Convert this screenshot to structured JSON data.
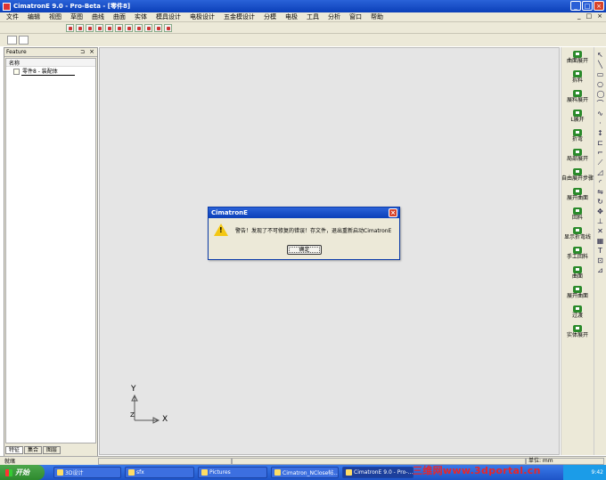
{
  "window": {
    "title": "CimatronE 9.0 - Pro-Beta - [零件8]",
    "controls": [
      "_",
      "□",
      "×"
    ]
  },
  "menu": {
    "items": [
      "文件",
      "编辑",
      "视图",
      "草图",
      "曲线",
      "曲面",
      "实体",
      "模具设计",
      "电极设计",
      "五金模设计",
      "分模",
      "电极",
      "工具",
      "分析",
      "窗口",
      "帮助"
    ],
    "mdi_controls": [
      "_",
      "□",
      "×"
    ]
  },
  "left_panel": {
    "title": "Feature",
    "pin": "⊐",
    "close": "×",
    "column_header": "名称",
    "tree_item": "零件8 - 装配体",
    "tabs": [
      "特征",
      "集合",
      "图层"
    ]
  },
  "canvas": {
    "axis_x": "X",
    "axis_y": "Y",
    "axis_z": "Z"
  },
  "right_toolbar": {
    "items": [
      "曲面展开",
      "拆料",
      "展料展开",
      "L展开",
      "折弯",
      "局部展开",
      "自由展开步骤",
      "展开曲面",
      "回料",
      "显示折弯线",
      "手工回料",
      "曲面",
      "展开曲面",
      "过渡",
      "实体展开"
    ]
  },
  "dialog": {
    "title": "CimatronE",
    "message": "警告！发现了不可修复的错误！存文件，退出重新启动CimatronE",
    "ok_label": "确定",
    "close": "×"
  },
  "statusbar": {
    "left": "就绪",
    "cell1": "",
    "cell2": "",
    "cell3": "单位: mm"
  },
  "taskbar": {
    "start_label": "开始",
    "tasks": [
      "3D设计",
      "sfx",
      "Pictures",
      "Cimatron_NClose帖...",
      "CimatronE 9.0 - Pro-..."
    ],
    "clock": "9:42"
  },
  "watermark": "三维网www.3dportal.cn"
}
